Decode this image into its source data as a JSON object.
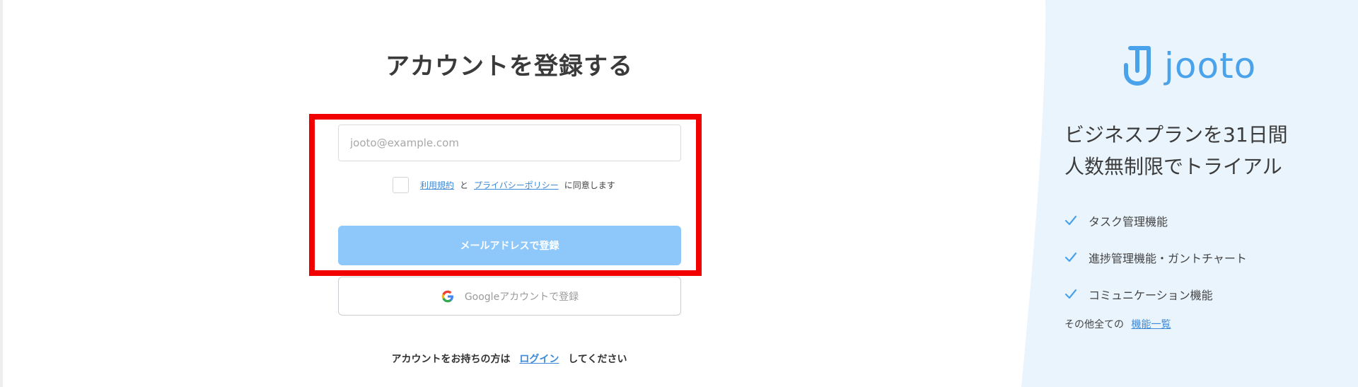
{
  "form": {
    "title": "アカウントを登録する",
    "email_placeholder": "jooto@example.com",
    "email_value": "",
    "terms_link": "利用規約",
    "terms_and": "と",
    "privacy_link": "プライバシーポリシー",
    "agree_suffix": "に同意します",
    "email_button": "メールアドレスで登録",
    "google_button": "Googleアカウントで登録",
    "login_prefix": "アカウントをお持ちの方は",
    "login_link": "ログイン",
    "login_suffix": "してください"
  },
  "sidebar": {
    "logo_text": "jooto",
    "promo_line1": "ビジネスプランを31日間",
    "promo_line2": "人数無制限でトライアル",
    "features": [
      {
        "label": "タスク管理機能",
        "icon": "check-icon"
      },
      {
        "label": "進捗管理機能・ガントチャート",
        "icon": "check-icon"
      },
      {
        "label": "コミュニケーション機能",
        "icon": "check-icon"
      }
    ],
    "all_features_prefix": "その他全ての",
    "all_features_link": "機能一覧"
  },
  "colors": {
    "accent": "#3d8ad9",
    "logo": "#4aa3ea",
    "button_primary": "#8ec8fb",
    "highlight": "#f20000",
    "sidebar_bg": "#eaf4fd"
  }
}
